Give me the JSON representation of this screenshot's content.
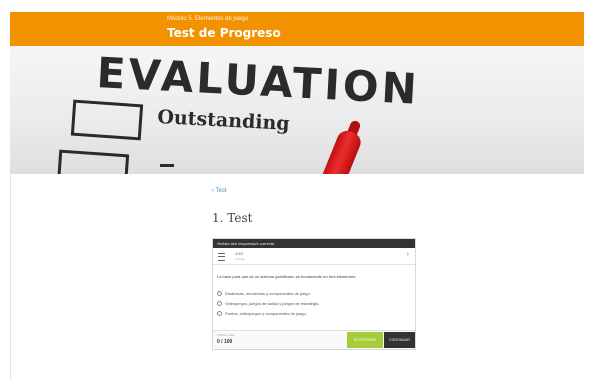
{
  "header": {
    "breadcrumb_line": "Módulo 5. Elementos de juego",
    "title": "Test de Progreso",
    "bg_color": "#f39200"
  },
  "hero": {
    "image_text": "EVALUATION",
    "option_text": "Outstanding",
    "marker_color": "#e02020"
  },
  "content": {
    "back_link": "‹ Test",
    "heading": "1. Test"
  },
  "quiz": {
    "instruction": "Señala la/s respuesta/s correcta",
    "question_number": "1/10",
    "question_meta": "1 punto",
    "question_text": "La base para que de un sistema gamificado se fundamente en tres elementos:",
    "options": [
      "Dinámicas, mecánicas y componentes de juego.",
      "Videojuegos, juegos de salida y juegos de estrategia.",
      "Puntos, videojuegos y componentes de juego."
    ],
    "points_label": "Puntos / total",
    "points_value": "0 / 100",
    "check_button": "RESPONDER",
    "next_button": "CONTINUAR",
    "accent_green": "#a6cc3a",
    "dark": "#333333"
  }
}
